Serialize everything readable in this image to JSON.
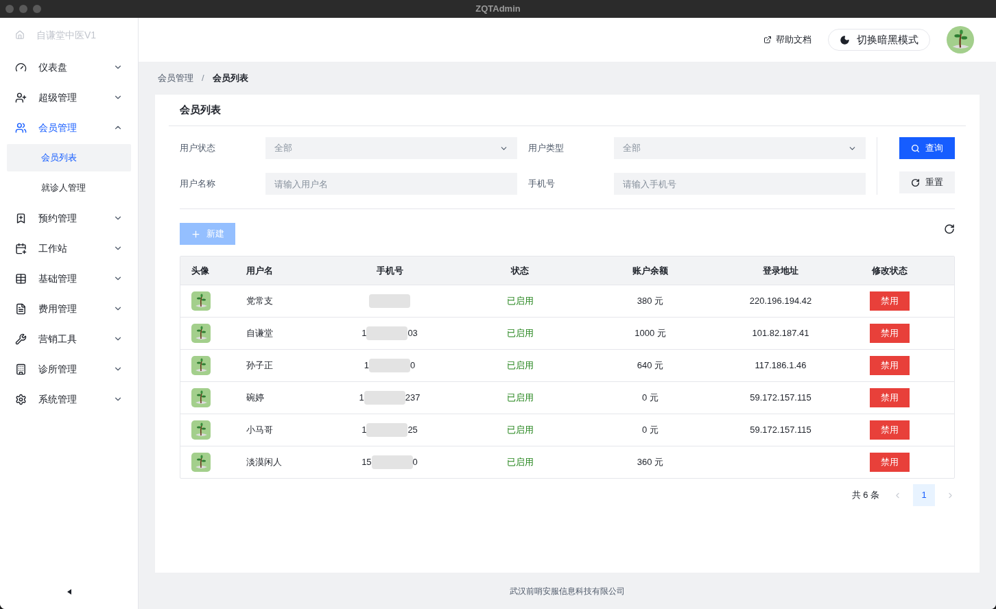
{
  "window": {
    "title": "ZQTAdmin"
  },
  "sidebar": {
    "brand": "自谦堂中医V1",
    "items": [
      {
        "label": "仪表盘",
        "expanded": false,
        "selected": false
      },
      {
        "label": "超级管理",
        "expanded": false,
        "selected": false
      },
      {
        "label": "会员管理",
        "expanded": true,
        "selected": true,
        "children": [
          {
            "label": "会员列表",
            "selected": true
          },
          {
            "label": "就诊人管理",
            "selected": false
          }
        ]
      },
      {
        "label": "预约管理",
        "expanded": false,
        "selected": false
      },
      {
        "label": "工作站",
        "expanded": false,
        "selected": false
      },
      {
        "label": "基础管理",
        "expanded": false,
        "selected": false
      },
      {
        "label": "费用管理",
        "expanded": false,
        "selected": false
      },
      {
        "label": "营销工具",
        "expanded": false,
        "selected": false
      },
      {
        "label": "诊所管理",
        "expanded": false,
        "selected": false
      },
      {
        "label": "系统管理",
        "expanded": false,
        "selected": false
      }
    ]
  },
  "header": {
    "help": "帮助文档",
    "theme_toggle": "切换暗黑模式"
  },
  "breadcrumb": [
    "会员管理",
    "会员列表"
  ],
  "breadcrumb_separator": "/",
  "card": {
    "title": "会员列表"
  },
  "filters": [
    {
      "label": "用户状态",
      "kind": "select",
      "value": "全部"
    },
    {
      "label": "用户类型",
      "kind": "select",
      "value": "全部"
    },
    {
      "label": "用户名称",
      "kind": "input",
      "placeholder": "请输入用户名"
    },
    {
      "label": "手机号",
      "kind": "input",
      "placeholder": "请输入手机号"
    }
  ],
  "search_button": "查询",
  "reset_button": "重置",
  "new_button": "新建",
  "table": {
    "columns": [
      "头像",
      "用户名",
      "手机号",
      "状态",
      "账户余额",
      "登录地址",
      "修改状态"
    ],
    "rows": [
      {
        "name": "党常支",
        "phone_head": "",
        "phone_tail": "",
        "status": "已启用",
        "balance": "380 元",
        "ip": "220.196.194.42",
        "action": "禁用"
      },
      {
        "name": "自谦堂",
        "phone_head": "1",
        "phone_tail": "03",
        "status": "已启用",
        "balance": "1000 元",
        "ip": "101.82.187.41",
        "action": "禁用"
      },
      {
        "name": "孙子正",
        "phone_head": "1",
        "phone_tail": "0",
        "status": "已启用",
        "balance": "640 元",
        "ip": "117.186.1.46",
        "action": "禁用"
      },
      {
        "name": "碗婷",
        "phone_head": "1",
        "phone_tail": "237",
        "status": "已启用",
        "balance": "0 元",
        "ip": "59.172.157.115",
        "action": "禁用"
      },
      {
        "name": "小马哥",
        "phone_head": "1",
        "phone_tail": "25",
        "status": "已启用",
        "balance": "0 元",
        "ip": "59.172.157.115",
        "action": "禁用"
      },
      {
        "name": "淡漠闲人",
        "phone_head": "15",
        "phone_tail": "0",
        "status": "已启用",
        "balance": "360 元",
        "ip": "",
        "action": "禁用"
      }
    ]
  },
  "pagination": {
    "total": "共 6 条",
    "pages": [
      {
        "label": "1",
        "selected": true
      }
    ]
  },
  "footer": "武汉前哨安服信息科技有限公司"
}
